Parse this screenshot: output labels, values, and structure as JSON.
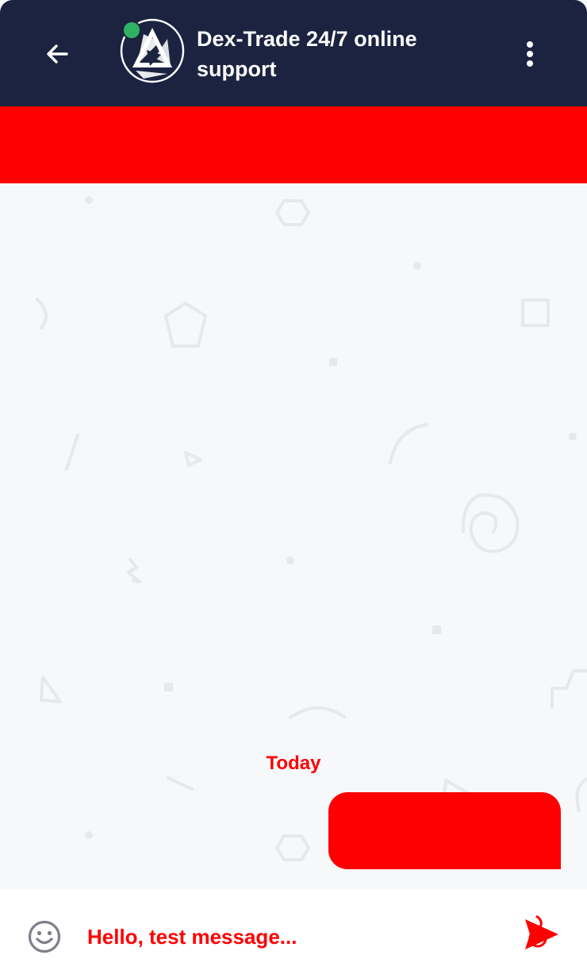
{
  "header": {
    "title": "Dex-Trade 24/7 online support",
    "status": "online",
    "background_color": "#1b2340",
    "status_color": "#2fb163",
    "icons": {
      "back": "arrow-left-icon",
      "avatar": "dex-trade-logo",
      "menu": "more-vertical-icon"
    }
  },
  "banner": {
    "color": "#ff0000"
  },
  "chat": {
    "date_separator": "Today",
    "messages": [
      {
        "direction": "outgoing",
        "color": "#ff0000"
      }
    ]
  },
  "composer": {
    "placeholder": "Hello, test message...",
    "icons": {
      "emoji": "smile-icon",
      "send": "send-icon"
    }
  }
}
